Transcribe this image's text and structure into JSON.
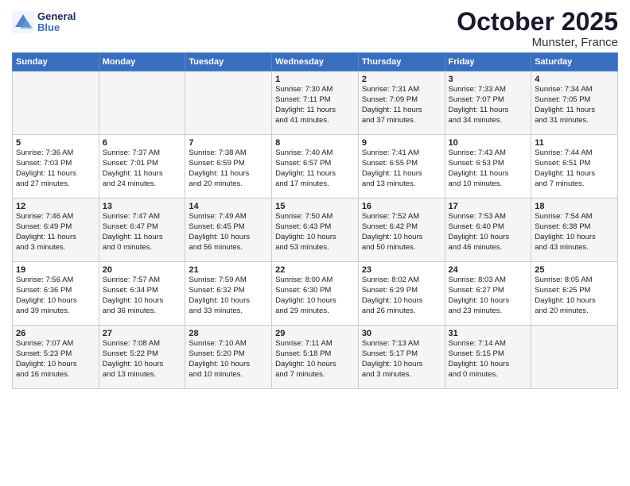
{
  "logo": {
    "line1": "General",
    "line2": "Blue"
  },
  "title": "October 2025",
  "location": "Munster, France",
  "days_header": [
    "Sunday",
    "Monday",
    "Tuesday",
    "Wednesday",
    "Thursday",
    "Friday",
    "Saturday"
  ],
  "weeks": [
    [
      {
        "num": "",
        "info": ""
      },
      {
        "num": "",
        "info": ""
      },
      {
        "num": "",
        "info": ""
      },
      {
        "num": "1",
        "info": "Sunrise: 7:30 AM\nSunset: 7:11 PM\nDaylight: 11 hours\nand 41 minutes."
      },
      {
        "num": "2",
        "info": "Sunrise: 7:31 AM\nSunset: 7:09 PM\nDaylight: 11 hours\nand 37 minutes."
      },
      {
        "num": "3",
        "info": "Sunrise: 7:33 AM\nSunset: 7:07 PM\nDaylight: 11 hours\nand 34 minutes."
      },
      {
        "num": "4",
        "info": "Sunrise: 7:34 AM\nSunset: 7:05 PM\nDaylight: 11 hours\nand 31 minutes."
      }
    ],
    [
      {
        "num": "5",
        "info": "Sunrise: 7:36 AM\nSunset: 7:03 PM\nDaylight: 11 hours\nand 27 minutes."
      },
      {
        "num": "6",
        "info": "Sunrise: 7:37 AM\nSunset: 7:01 PM\nDaylight: 11 hours\nand 24 minutes."
      },
      {
        "num": "7",
        "info": "Sunrise: 7:38 AM\nSunset: 6:59 PM\nDaylight: 11 hours\nand 20 minutes."
      },
      {
        "num": "8",
        "info": "Sunrise: 7:40 AM\nSunset: 6:57 PM\nDaylight: 11 hours\nand 17 minutes."
      },
      {
        "num": "9",
        "info": "Sunrise: 7:41 AM\nSunset: 6:55 PM\nDaylight: 11 hours\nand 13 minutes."
      },
      {
        "num": "10",
        "info": "Sunrise: 7:43 AM\nSunset: 6:53 PM\nDaylight: 11 hours\nand 10 minutes."
      },
      {
        "num": "11",
        "info": "Sunrise: 7:44 AM\nSunset: 6:51 PM\nDaylight: 11 hours\nand 7 minutes."
      }
    ],
    [
      {
        "num": "12",
        "info": "Sunrise: 7:46 AM\nSunset: 6:49 PM\nDaylight: 11 hours\nand 3 minutes."
      },
      {
        "num": "13",
        "info": "Sunrise: 7:47 AM\nSunset: 6:47 PM\nDaylight: 11 hours\nand 0 minutes."
      },
      {
        "num": "14",
        "info": "Sunrise: 7:49 AM\nSunset: 6:45 PM\nDaylight: 10 hours\nand 56 minutes."
      },
      {
        "num": "15",
        "info": "Sunrise: 7:50 AM\nSunset: 6:43 PM\nDaylight: 10 hours\nand 53 minutes."
      },
      {
        "num": "16",
        "info": "Sunrise: 7:52 AM\nSunset: 6:42 PM\nDaylight: 10 hours\nand 50 minutes."
      },
      {
        "num": "17",
        "info": "Sunrise: 7:53 AM\nSunset: 6:40 PM\nDaylight: 10 hours\nand 46 minutes."
      },
      {
        "num": "18",
        "info": "Sunrise: 7:54 AM\nSunset: 6:38 PM\nDaylight: 10 hours\nand 43 minutes."
      }
    ],
    [
      {
        "num": "19",
        "info": "Sunrise: 7:56 AM\nSunset: 6:36 PM\nDaylight: 10 hours\nand 39 minutes."
      },
      {
        "num": "20",
        "info": "Sunrise: 7:57 AM\nSunset: 6:34 PM\nDaylight: 10 hours\nand 36 minutes."
      },
      {
        "num": "21",
        "info": "Sunrise: 7:59 AM\nSunset: 6:32 PM\nDaylight: 10 hours\nand 33 minutes."
      },
      {
        "num": "22",
        "info": "Sunrise: 8:00 AM\nSunset: 6:30 PM\nDaylight: 10 hours\nand 29 minutes."
      },
      {
        "num": "23",
        "info": "Sunrise: 8:02 AM\nSunset: 6:29 PM\nDaylight: 10 hours\nand 26 minutes."
      },
      {
        "num": "24",
        "info": "Sunrise: 8:03 AM\nSunset: 6:27 PM\nDaylight: 10 hours\nand 23 minutes."
      },
      {
        "num": "25",
        "info": "Sunrise: 8:05 AM\nSunset: 6:25 PM\nDaylight: 10 hours\nand 20 minutes."
      }
    ],
    [
      {
        "num": "26",
        "info": "Sunrise: 7:07 AM\nSunset: 5:23 PM\nDaylight: 10 hours\nand 16 minutes."
      },
      {
        "num": "27",
        "info": "Sunrise: 7:08 AM\nSunset: 5:22 PM\nDaylight: 10 hours\nand 13 minutes."
      },
      {
        "num": "28",
        "info": "Sunrise: 7:10 AM\nSunset: 5:20 PM\nDaylight: 10 hours\nand 10 minutes."
      },
      {
        "num": "29",
        "info": "Sunrise: 7:11 AM\nSunset: 5:18 PM\nDaylight: 10 hours\nand 7 minutes."
      },
      {
        "num": "30",
        "info": "Sunrise: 7:13 AM\nSunset: 5:17 PM\nDaylight: 10 hours\nand 3 minutes."
      },
      {
        "num": "31",
        "info": "Sunrise: 7:14 AM\nSunset: 5:15 PM\nDaylight: 10 hours\nand 0 minutes."
      },
      {
        "num": "",
        "info": ""
      }
    ]
  ]
}
